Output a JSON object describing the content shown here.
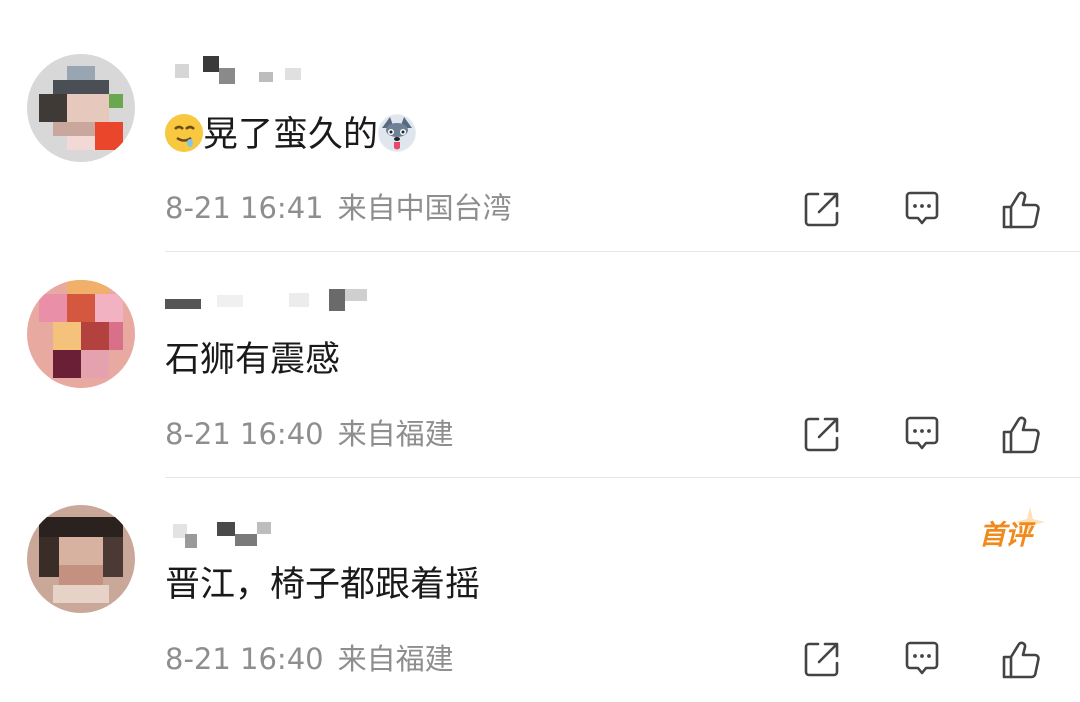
{
  "comments": [
    {
      "text": "晃了蛮久的",
      "emoji_before": "drooling-face",
      "emoji_after": "husky-tongue",
      "time": "8-21 16:41",
      "location": "来自中国台湾",
      "first_comment": false
    },
    {
      "text": "石狮有震感",
      "time": "8-21 16:40",
      "location": "来自福建",
      "first_comment": false
    },
    {
      "text": "晋江，椅子都跟着摇",
      "time": "8-21 16:40",
      "location": "来自福建",
      "first_comment": true
    }
  ],
  "badge": {
    "label": "首评",
    "color": "#f08a1c"
  },
  "icons": [
    "share-icon",
    "reply-icon",
    "like-icon"
  ]
}
